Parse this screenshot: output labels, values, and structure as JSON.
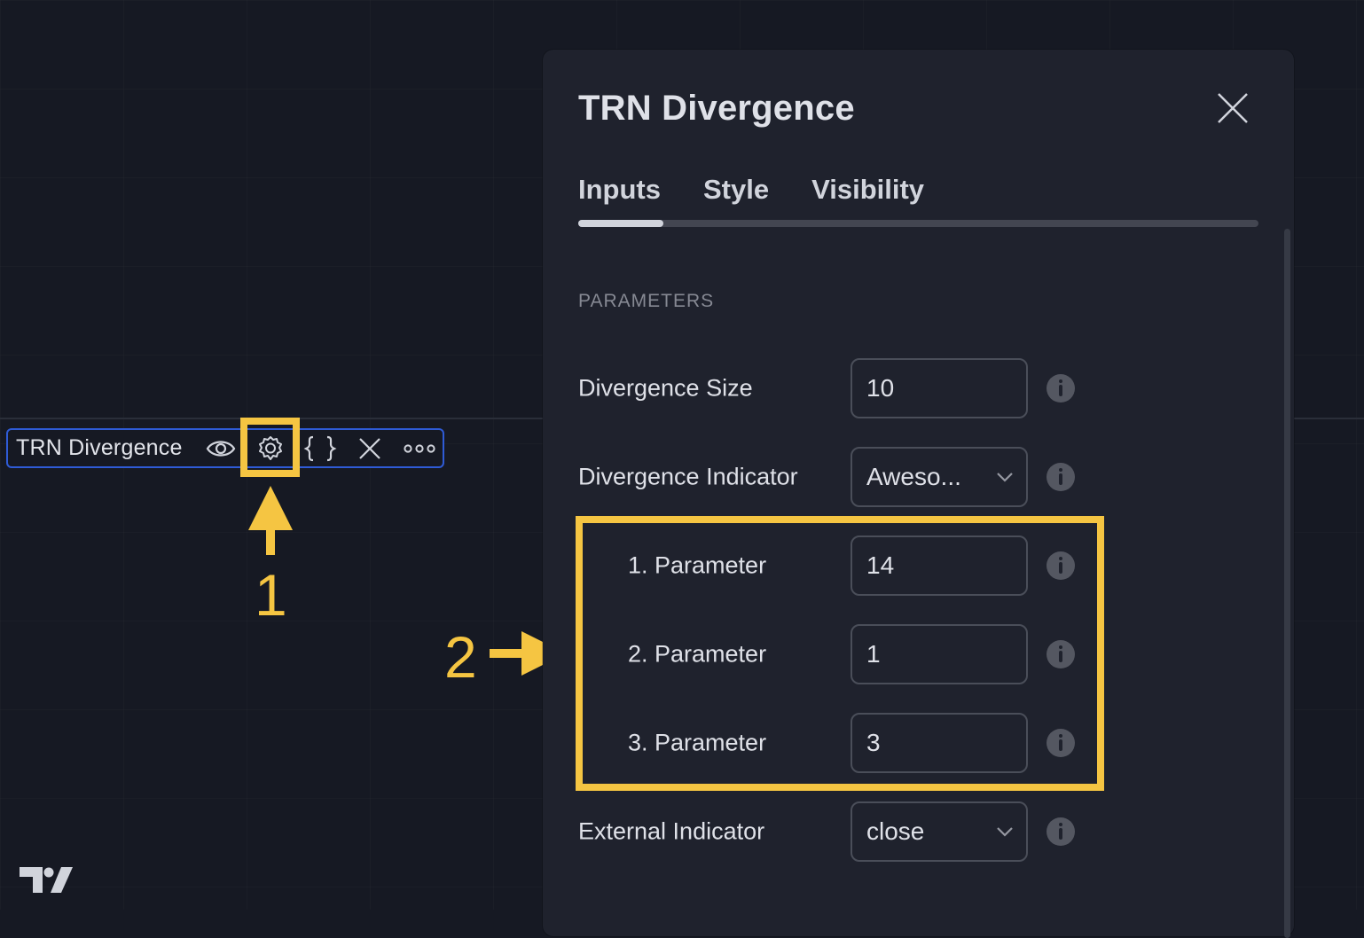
{
  "legend": {
    "title": "TRN Divergence",
    "buttons": [
      {
        "name": "eye-icon",
        "label": "Show/Hide"
      },
      {
        "name": "gear-icon",
        "label": "Settings"
      },
      {
        "name": "braces-icon",
        "label": "Source code"
      },
      {
        "name": "close-icon",
        "label": "Remove"
      },
      {
        "name": "more-icon",
        "label": "More"
      }
    ]
  },
  "annotations": {
    "step1": "1",
    "step2": "2",
    "color": "#f5c542"
  },
  "dialog": {
    "title": "TRN Divergence",
    "tabs": [
      {
        "label": "Inputs",
        "active": true
      },
      {
        "label": "Style",
        "active": false
      },
      {
        "label": "Visibility",
        "active": false
      }
    ],
    "section_header": "PARAMETERS",
    "rows": [
      {
        "label": "Divergence Size",
        "type": "number",
        "value": "10"
      },
      {
        "label": "Divergence Indicator",
        "type": "select",
        "value": "Aweso..."
      },
      {
        "label": "1. Parameter",
        "type": "number",
        "value": "14"
      },
      {
        "label": "2. Parameter",
        "type": "number",
        "value": "1"
      },
      {
        "label": "3. Parameter",
        "type": "number",
        "value": "3"
      },
      {
        "label": "External Indicator",
        "type": "select",
        "value": "close"
      }
    ]
  },
  "colors": {
    "background": "#161923",
    "dialog_bg": "#1f222d",
    "legend_border": "#2f5bd6",
    "highlight": "#f5c542",
    "text": "#dfe1e8",
    "muted": "#868993"
  }
}
